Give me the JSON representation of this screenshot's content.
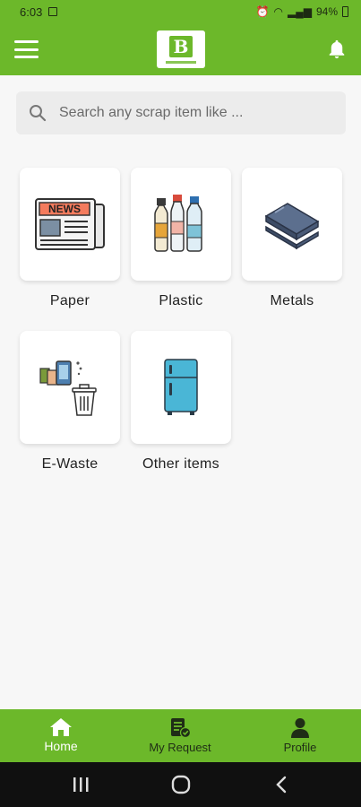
{
  "status_bar": {
    "time": "6:03",
    "battery": "94%"
  },
  "app_bar": {
    "logo_letter": "B",
    "menu_icon": "hamburger-menu-icon",
    "notification_icon": "bell-icon"
  },
  "search": {
    "placeholder": "Search any scrap item like ...",
    "value": ""
  },
  "categories": [
    {
      "label": "Paper",
      "icon": "newspaper-icon"
    },
    {
      "label": "Plastic",
      "icon": "plastic-bottles-icon"
    },
    {
      "label": "Metals",
      "icon": "metal-beams-icon"
    },
    {
      "label": "E-Waste",
      "icon": "ewaste-phone-bin-icon"
    },
    {
      "label": "Other items",
      "icon": "refrigerator-icon"
    }
  ],
  "bottom_nav": {
    "items": [
      {
        "label": "Home",
        "icon": "home-icon",
        "active": true
      },
      {
        "label": "My Request",
        "icon": "request-list-icon",
        "active": false
      },
      {
        "label": "Profile",
        "icon": "profile-icon",
        "active": false
      }
    ]
  },
  "colors": {
    "brand": "#6cb82a",
    "background": "#f7f7f7",
    "tile": "#ffffff"
  }
}
